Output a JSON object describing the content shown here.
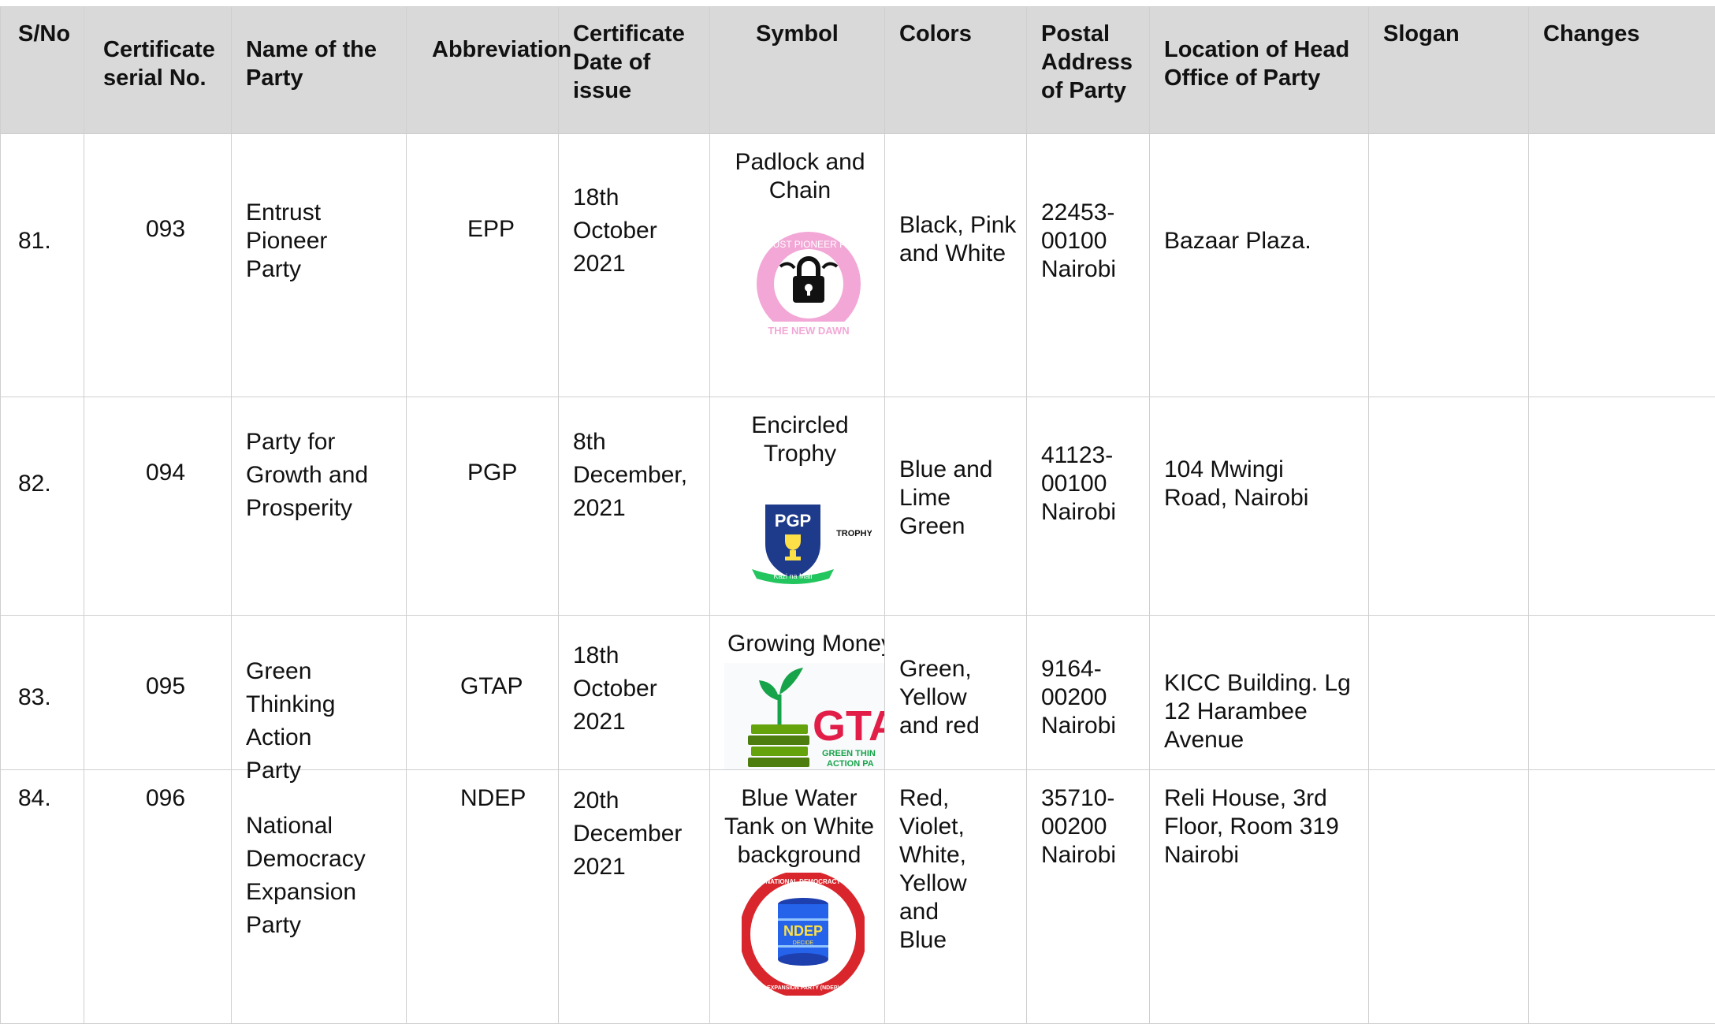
{
  "headers": {
    "sno": "S/No",
    "serial": "Certificate serial No.",
    "name": "Name of the Party",
    "abbr": "Abbreviation",
    "date": "Certificate Date of issue",
    "symbol": "Symbol",
    "colors": "Colors",
    "postal": "Postal Address of Party",
    "location": "Location of Head Office of Party",
    "slogan": "Slogan",
    "changes": "Changes"
  },
  "rows": [
    {
      "sno": "81.",
      "serial": "093",
      "name": "Entrust Pioneer Party",
      "abbr": "EPP",
      "date": "18th October 2021",
      "symbol": "Padlock and Chain",
      "colors": "Black, Pink and White",
      "postal": "22453-00100 Nairobi",
      "location": "Bazaar Plaza.",
      "slogan": "",
      "changes": "",
      "logo": {
        "ring_text": "ENTRUST PIONEER PARTY",
        "bottom_text": "THE NEW DAWN",
        "color": "#f2a7d6"
      }
    },
    {
      "sno": "82.",
      "serial": "094",
      "name": "Party for Growth and Prosperity",
      "abbr": "PGP",
      "date": "8th December, 2021",
      "symbol": "Encircled Trophy",
      "colors": "Blue and Lime Green",
      "postal": "41123-00100 Nairobi",
      "location": "104 Mwingi Road, Nairobi",
      "slogan": "",
      "changes": "",
      "logo": {
        "badge_text": "PGP",
        "side_text": "TROPHY",
        "ribbon_text": "Kazi na Mali",
        "color": "#1e3a8a"
      }
    },
    {
      "sno": "83.",
      "serial": "095",
      "name": "Green Thinking Action Party",
      "abbr": "GTAP",
      "date": "18th October 2021",
      "symbol": "Growing Money",
      "colors": "Green, Yellow and red",
      "postal": "9164-00200 Nairobi",
      "location": "KICC Building. Lg 12 Harambee Avenue",
      "slogan": "",
      "changes": "",
      "logo": {
        "letters": "GTA",
        "sub_line1": "GREEN THIN",
        "sub_line2": "ACTION PA",
        "color": "#e11d48"
      }
    },
    {
      "sno": "84.",
      "serial": "096",
      "name": "National Democracy Expansion Party",
      "abbr": "NDEP",
      "date": "20th December 2021",
      "symbol": "Blue Water Tank on White background",
      "colors": "Red, Violet, White, Yellow and Blue",
      "postal": "35710-00200 Nairobi",
      "location": "Reli House, 3rd Floor, Room 319 Nairobi",
      "slogan": "",
      "changes": "",
      "logo": {
        "tank_text": "NDEP",
        "tank_sub": "DECIDE",
        "ring_top": "NATIONAL DEMOCRACY",
        "ring_bottom": "EXPANSION PARTY (NDEP)",
        "color": "#d9262c"
      }
    }
  ]
}
